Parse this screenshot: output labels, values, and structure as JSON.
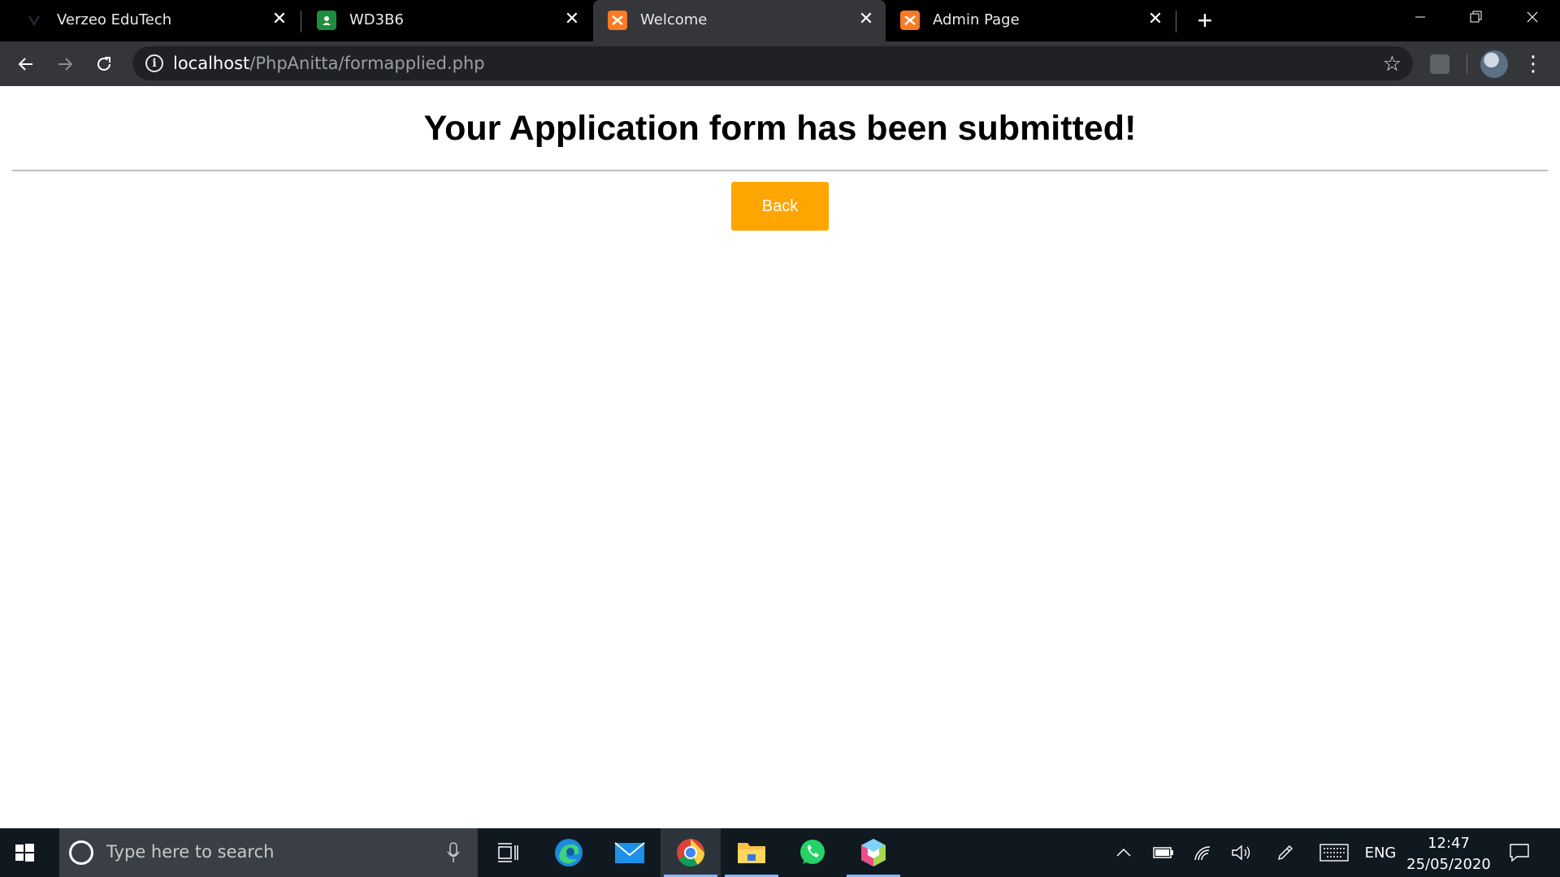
{
  "browser": {
    "tabs": [
      {
        "title": "Verzeo EduTech",
        "icon": "verzeo-icon",
        "active": false
      },
      {
        "title": "WD3B6",
        "icon": "classroom-icon",
        "active": false
      },
      {
        "title": "Welcome",
        "icon": "xampp-icon",
        "active": true
      },
      {
        "title": "Admin Page",
        "icon": "xampp-icon",
        "active": false
      }
    ],
    "close_glyph": "✕",
    "new_tab_glyph": "+",
    "url_host": "localhost",
    "url_path": "/PhpAnitta/formapplied.php",
    "info_glyph": "i",
    "star_glyph": "☆",
    "menu_glyph": "⋮"
  },
  "page": {
    "heading": "Your Application form has been submitted!",
    "back_label": "Back",
    "button_color": "#ffa500"
  },
  "taskbar": {
    "search_placeholder": "Type here to search",
    "language": "ENG",
    "time": "12:47",
    "date": "25/05/2020"
  }
}
